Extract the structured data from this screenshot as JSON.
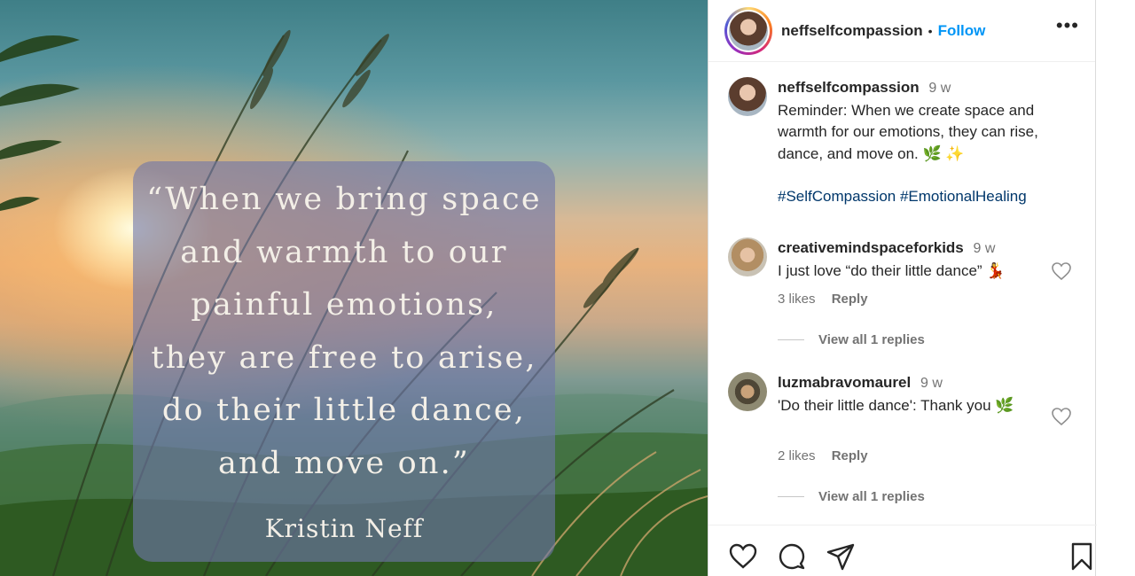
{
  "post_image": {
    "quote": "“When we bring space and warmth to our painful emotions, they are free to arise, do their little dance, and move on.”",
    "quote_lines": [
      "“When we bring space",
      "and warmth to our",
      "painful emotions,",
      "they are free to arise,",
      "do their little dance,",
      "and move on.”"
    ],
    "author": "Kristin Neff"
  },
  "header": {
    "username": "neffselfcompassion",
    "separator": "•",
    "follow_label": "Follow",
    "more_label": "•••"
  },
  "caption": {
    "username": "neffselfcompassion",
    "time": "9 w",
    "text": "Reminder: When we create space and warmth for our emotions, they can rise, dance, and move on. 🌿 ✨",
    "hashtags": "#SelfCompassion #EmotionalHealing"
  },
  "comments": [
    {
      "username": "creativemindspaceforkids",
      "time": "9 w",
      "text": "I just love “do their little dance” 💃",
      "likes": "3 likes",
      "reply_label": "Reply",
      "view_replies": "View all 1 replies"
    },
    {
      "username": "luzmabravomaurel",
      "time": "9 w",
      "text": "'Do their little dance': Thank you 🌿",
      "likes": "2 likes",
      "reply_label": "Reply",
      "view_replies": "View all 1 replies"
    }
  ],
  "icons": {
    "like": "heart-icon",
    "comment": "comment-icon",
    "share": "paper-plane-icon",
    "save": "bookmark-icon",
    "more": "ellipsis-icon"
  },
  "colors": {
    "follow": "#0095f6",
    "hashtag": "#00376b",
    "muted": "#737373"
  }
}
